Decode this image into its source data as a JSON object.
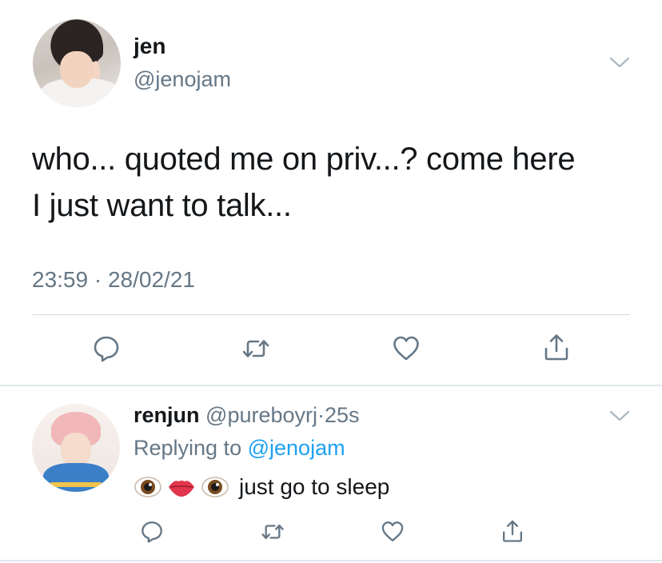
{
  "tweet": {
    "display_name": "jen",
    "handle": "@jenojam",
    "text_lines": [
      "who... quoted me on priv...? come here",
      "I just want to talk..."
    ],
    "time": "23:59",
    "separator": "·",
    "date": "28/02/21"
  },
  "reply": {
    "display_name": "renjun",
    "handle": "@pureboyrj",
    "separator": "·",
    "age": "25s",
    "replying_prefix": "Replying to",
    "replying_handle": "@jenojam",
    "emojis": [
      "eye-emoji",
      "mouth-emoji",
      "eye-emoji"
    ],
    "text": "just go to sleep"
  },
  "icons": {
    "actions": [
      "reply-icon",
      "retweet-icon",
      "like-icon",
      "share-icon"
    ],
    "menu": "chevron-down-icon"
  },
  "colors": {
    "text": "#14171a",
    "secondary": "#657786",
    "link": "#1da1f2",
    "icon": "#657786",
    "divider": "#e1e8ed"
  }
}
